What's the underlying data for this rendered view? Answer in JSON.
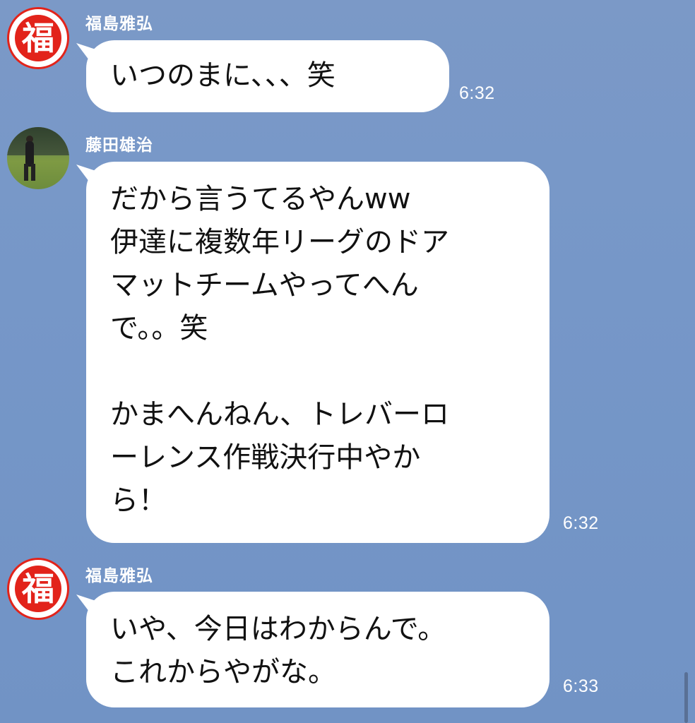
{
  "messages": [
    {
      "sender": "福島雅弘",
      "avatar_char": "福",
      "text": "いつのまに、、、笑",
      "time": "6:32"
    },
    {
      "sender": "藤田雄治",
      "text": "だから言うてるやんww\n伊達に複数年リーグのドア\nマットチームやってへん\nで。。笑\n\nかまへんねん、トレバーロ\nーレンス作戦決行中やか\nら！",
      "time": "6:32"
    },
    {
      "sender": "福島雅弘",
      "avatar_char": "福",
      "text": "いや、今日はわからんで。\nこれからやがな。",
      "time": "6:33"
    }
  ],
  "colors": {
    "background": "#7697c8",
    "bubble": "#ffffff",
    "avatar_red": "#e2231a"
  }
}
